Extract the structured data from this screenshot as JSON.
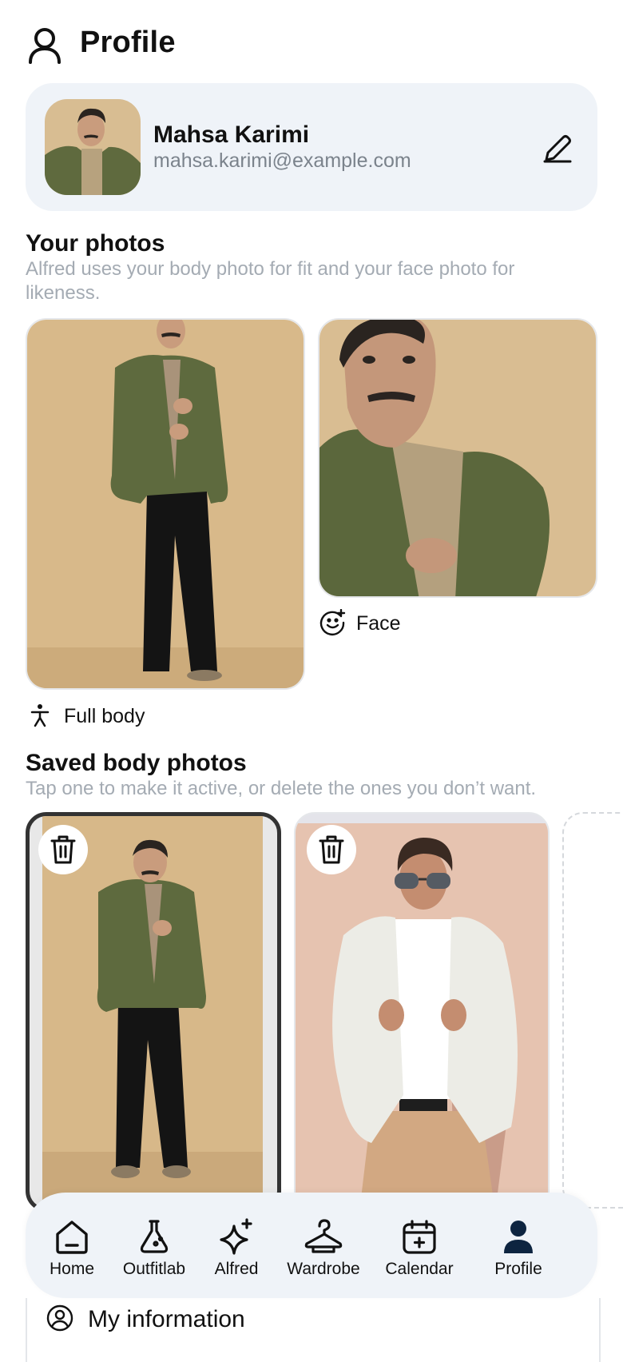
{
  "header": {
    "title": "Profile",
    "icon": "user-outline-icon"
  },
  "profile": {
    "name": "Mahsa Karimi",
    "email": "mahsa.karimi@example.com",
    "edit_icon": "pencil-icon"
  },
  "your_photos": {
    "title": "Your photos",
    "subtitle_line1": "Alfred uses your body photo for fit and your face photo for",
    "subtitle_line2": "likeness.",
    "full_body_label": "Full body",
    "face_label": "Face"
  },
  "saved_body_photos": {
    "title": "Saved body photos",
    "subtitle": "Tap one to make it active, or delete the ones you don’t want.",
    "items": [
      {
        "active": true,
        "delete_icon": "trash-icon"
      },
      {
        "active": false,
        "delete_icon": "trash-icon"
      }
    ]
  },
  "nav": {
    "items": [
      {
        "label": "Home",
        "icon": "home-icon"
      },
      {
        "label": "Outfitlab",
        "icon": "flask-icon"
      },
      {
        "label": "Alfred",
        "icon": "sparkles-icon"
      },
      {
        "label": "Wardrobe",
        "icon": "hanger-icon"
      },
      {
        "label": "Calendar",
        "icon": "calendar-plus-icon"
      },
      {
        "label": "Profile",
        "icon": "user-filled-icon",
        "active": true
      }
    ]
  },
  "menu": {
    "my_information": "My information"
  },
  "colors": {
    "card_bg": "#eff3f8",
    "muted_text": "#a4abb3",
    "active_border": "#333333",
    "nav_active": "#0d2440"
  }
}
